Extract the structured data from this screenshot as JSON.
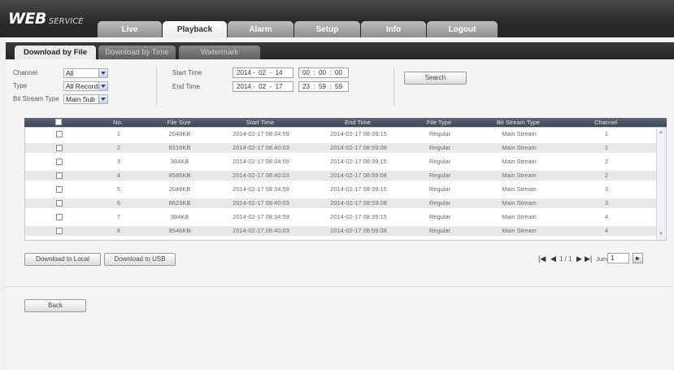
{
  "app": {
    "logo_main": "WEB",
    "logo_sub": "SERVICE"
  },
  "main_tabs": [
    {
      "label": "Live"
    },
    {
      "label": "Playback"
    },
    {
      "label": "Alarm"
    },
    {
      "label": "Setup"
    },
    {
      "label": "Info"
    },
    {
      "label": "Logout"
    }
  ],
  "active_main_tab": "Playback",
  "sub_tabs": [
    {
      "label": "Download by File"
    },
    {
      "label": "Download by Time"
    },
    {
      "label": "Watermark"
    }
  ],
  "active_sub_tab": "Download by File",
  "filters": {
    "channel_label": "Channel",
    "channel_value": "All",
    "type_label": "Type",
    "type_value": "All Records",
    "bitstream_label": "Bit Stream Type",
    "bitstream_value": "Main Sub",
    "start_label": "Start Time",
    "start_date": "2014 -  02  -  14",
    "start_time": "00  :  00  :  00",
    "end_label": "End Time",
    "end_date": "2014 -  02  -  17",
    "end_time": "23  :  59  :  59",
    "search_label": "Search"
  },
  "table": {
    "headers": [
      "No.",
      "File Size",
      "Start Time",
      "End Time",
      "File Type",
      "Bit Stream Type",
      "Channel"
    ],
    "rows": [
      [
        "1",
        "2048KB",
        "2014-02-17 08:34:59",
        "2014-02-17 08:39:15",
        "Regular",
        "Main Stream",
        "1"
      ],
      [
        "2",
        "8316KB",
        "2014-02-17 08:40:03",
        "2014-02-17 08:59:08",
        "Regular",
        "Main Stream",
        "1"
      ],
      [
        "3",
        "384KB",
        "2014-02-17 08:34:59",
        "2014-02-17 08:39:15",
        "Regular",
        "Main Stream",
        "2"
      ],
      [
        "4",
        "8585KB",
        "2014-02-17 08:40:03",
        "2014-02-17 08:59:08",
        "Regular",
        "Main Stream",
        "2"
      ],
      [
        "5",
        "2048KB",
        "2014-02-17 08:34:59",
        "2014-02-17 08:39:15",
        "Regular",
        "Main Stream",
        "3"
      ],
      [
        "6",
        "8623KB",
        "2014-02-17 08:40:03",
        "2014-02-17 08:59:08",
        "Regular",
        "Main Stream",
        "3"
      ],
      [
        "7",
        "384KB",
        "2014-02-17 08:34:59",
        "2014-02-17 08:39:15",
        "Regular",
        "Main Stream",
        "4"
      ],
      [
        "8",
        "8546KB",
        "2014-02-17 08:40:03",
        "2014-02-17 08:59:08",
        "Regular",
        "Main Stream",
        "4"
      ]
    ]
  },
  "actions": {
    "download_local": "Download to Local",
    "download_usb": "Download to USB",
    "back": "Back"
  },
  "pager": {
    "page_info": "1 / 1",
    "jump_label": "Jump To",
    "jump_value": "1"
  },
  "colors": {
    "topbar": "#2b2b2b",
    "table_header": "#4a5666",
    "row_alt": "#e8e8e8"
  }
}
